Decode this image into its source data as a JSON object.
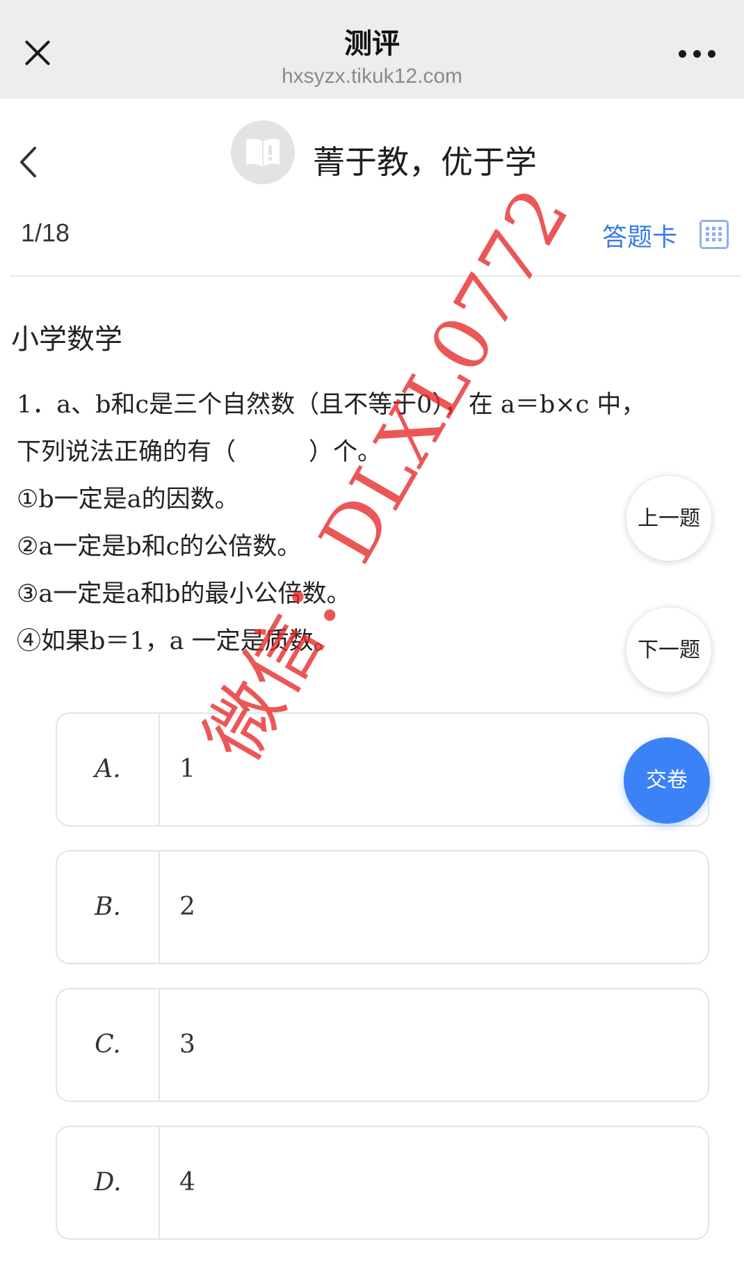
{
  "browser": {
    "title": "测评",
    "url": "hxsyzx.tikuk12.com"
  },
  "header": {
    "site_title": "菁于教，优于学"
  },
  "progress": {
    "counter": "1/18",
    "answer_card_label": "答题卡"
  },
  "question": {
    "subject": "小学数学",
    "lines": [
      "1．a、b和c是三个自然数（且不等于0），在 a＝b×c 中，",
      "下列说法正确的有（　　　）个。",
      "①b一定是a的因数。",
      "②a一定是b和c的公倍数。",
      "③a一定是a和b的最小公倍数。",
      "④如果b＝1，a 一定是质数。"
    ]
  },
  "options": [
    {
      "letter": "A.",
      "text": "1"
    },
    {
      "letter": "B.",
      "text": "2"
    },
    {
      "letter": "C.",
      "text": "3"
    },
    {
      "letter": "D.",
      "text": "4"
    }
  ],
  "nav": {
    "prev_label": "上一题",
    "next_label": "下一题",
    "submit_label": "交卷"
  },
  "watermark": "微信：DLXL0772",
  "colors": {
    "accent": "#3b7be9",
    "submit_button": "#3b82f6",
    "watermark": "#e62828",
    "topbar": "#ededed"
  }
}
